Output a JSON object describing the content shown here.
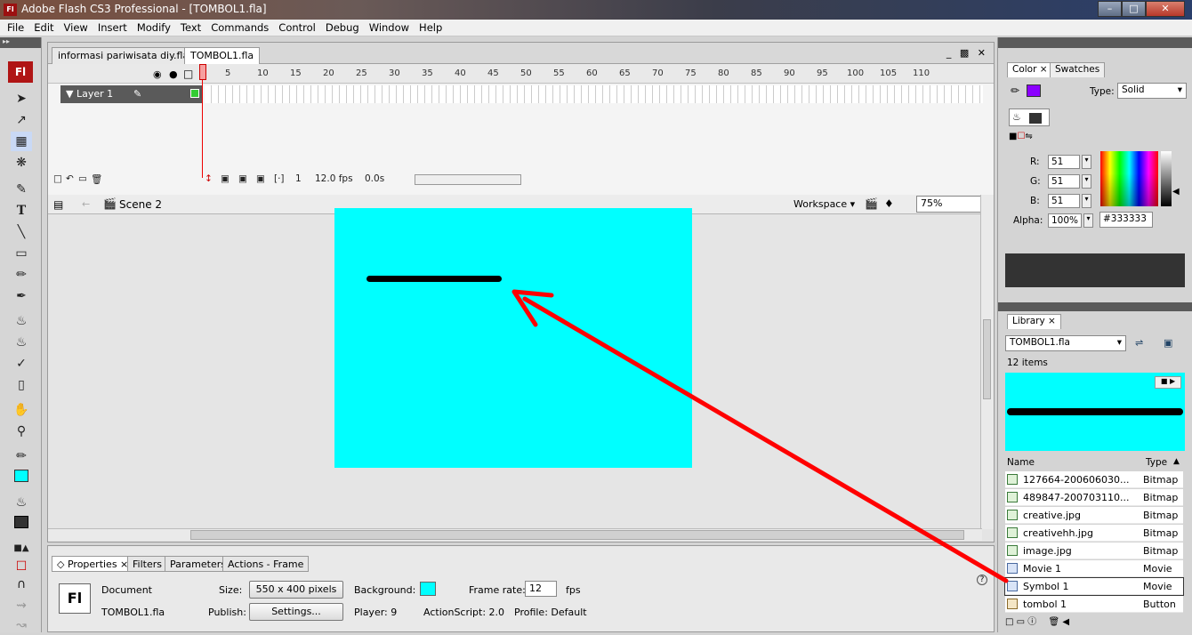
{
  "window": {
    "icon": "Fl",
    "title": "Adobe Flash CS3 Professional - [TOMBOL1.fla]"
  },
  "menu": [
    "File",
    "Edit",
    "View",
    "Insert",
    "Modify",
    "Text",
    "Commands",
    "Control",
    "Debug",
    "Window",
    "Help"
  ],
  "tools": {
    "badge": "Fl"
  },
  "doc_tabs": {
    "tab1": "informasi pariwisata diy.fla",
    "tab2": "TOMBOL1.fla"
  },
  "timeline": {
    "frame_numbers": [
      "5",
      "10",
      "15",
      "20",
      "25",
      "30",
      "35",
      "40",
      "45",
      "50",
      "55",
      "60",
      "65",
      "70",
      "75",
      "80",
      "85",
      "90",
      "95",
      "100",
      "105",
      "110"
    ],
    "layer_name": "Layer 1",
    "current_frame": "1",
    "fps": "12.0 fps",
    "time": "0.0s"
  },
  "scene": {
    "name": "Scene 2",
    "workspace": "Workspace",
    "zoom": "75%"
  },
  "stage": {
    "background": "#00ffff"
  },
  "properties": {
    "tabs": [
      "Properties",
      "Filters",
      "Parameters",
      "Actions - Frame"
    ],
    "logo": "Fl",
    "doc_label": "Document",
    "doc_name": "TOMBOL1.fla",
    "size_label": "Size:",
    "size_value": "550 x 400 pixels",
    "background_label": "Background:",
    "framerate_label": "Frame rate:",
    "framerate_value": "12",
    "fps_label": "fps",
    "publish_label": "Publish:",
    "settings_button": "Settings...",
    "player": "Player: 9",
    "actionscript": "ActionScript: 2.0",
    "profile": "Profile: Default"
  },
  "color_panel": {
    "tabs": [
      "Color",
      "Swatches"
    ],
    "type_label": "Type:",
    "type_value": "Solid",
    "r_label": "R:",
    "r": "51",
    "g_label": "G:",
    "g": "51",
    "b_label": "B:",
    "b": "51",
    "alpha_label": "Alpha:",
    "alpha": "100%",
    "hex": "#333333",
    "fill_color": "#333333"
  },
  "library": {
    "tab": "Library",
    "file": "TOMBOL1.fla",
    "count": "12 items",
    "col_name": "Name",
    "col_type": "Type",
    "items": [
      {
        "name": "127664-200606030...",
        "type": "Bitmap"
      },
      {
        "name": "489847-200703110...",
        "type": "Bitmap"
      },
      {
        "name": "creative.jpg",
        "type": "Bitmap"
      },
      {
        "name": "creativehh.jpg",
        "type": "Bitmap"
      },
      {
        "name": "image.jpg",
        "type": "Bitmap"
      },
      {
        "name": "Movie 1",
        "type": "Movie"
      },
      {
        "name": "Symbol 1",
        "type": "Movie"
      },
      {
        "name": "tombol 1",
        "type": "Button"
      }
    ]
  },
  "colors": {
    "annotation_arrow": "#ff0000",
    "stage": "#00ffff"
  }
}
